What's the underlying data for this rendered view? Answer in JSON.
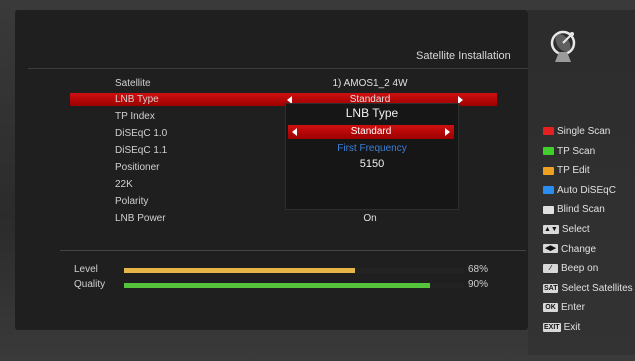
{
  "header": {
    "title": "Satellite Installation"
  },
  "settings": [
    {
      "label": "Satellite",
      "value": "1) AMOS1_2 4W"
    },
    {
      "label": "LNB Type",
      "value": "Standard"
    },
    {
      "label": "TP Index",
      "value": ""
    },
    {
      "label": "DiSEqC 1.0",
      "value": ""
    },
    {
      "label": "DiSEqC 1.1",
      "value": ""
    },
    {
      "label": "Positioner",
      "value": ""
    },
    {
      "label": "22K",
      "value": ""
    },
    {
      "label": "Polarity",
      "value": ""
    },
    {
      "label": "LNB Power",
      "value": "On"
    }
  ],
  "popup": {
    "title": "LNB Type",
    "selected": "Standard",
    "subtitle": "First Frequency",
    "value": "5150"
  },
  "meters": {
    "level": {
      "label": "Level",
      "percent_text": "68%",
      "fraction": 0.68,
      "color": "#e6b547"
    },
    "quality": {
      "label": "Quality",
      "percent_text": "90%",
      "fraction": 0.9,
      "color": "#56c43a"
    }
  },
  "legend": [
    {
      "key_type": "swatch",
      "color": "#e52020",
      "label": "Single Scan"
    },
    {
      "key_type": "swatch",
      "color": "#3fd02a",
      "label": "TP Scan"
    },
    {
      "key_type": "swatch",
      "color": "#f0a020",
      "label": "TP Edit"
    },
    {
      "key_type": "swatch",
      "color": "#2a8ef0",
      "label": "Auto DiSEqC"
    },
    {
      "key_type": "swatch",
      "color": "#e0e0e0",
      "label": "Blind Scan"
    },
    {
      "key_type": "key",
      "key": "▲▼",
      "label": "Select"
    },
    {
      "key_type": "key",
      "key": "◀▶",
      "label": "Change"
    },
    {
      "key_type": "key",
      "key": "⁄",
      "label": "Beep on"
    },
    {
      "key_type": "key",
      "key": "SAT",
      "label": "Select Satellites"
    },
    {
      "key_type": "key",
      "key": "OK",
      "label": "Enter"
    },
    {
      "key_type": "key",
      "key": "EXIT",
      "label": "Exit"
    }
  ],
  "icons": {
    "header": "satellite-dish-icon"
  }
}
